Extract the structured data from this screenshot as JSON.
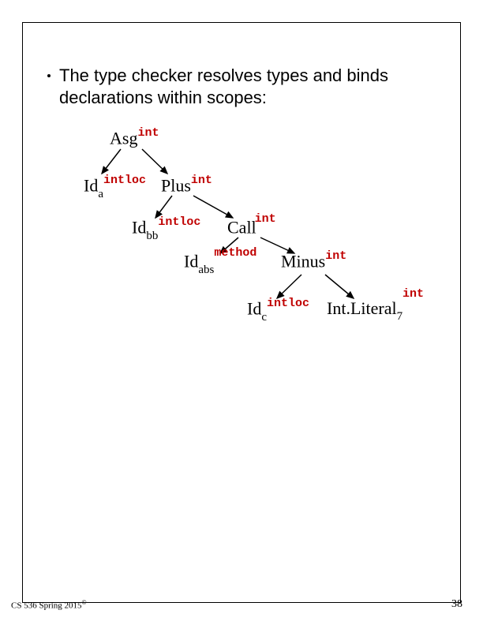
{
  "bullet": "The type checker resolves types and binds declarations within scopes:",
  "nodes": {
    "asg": {
      "base": "Asg",
      "sub": "",
      "sup": "int"
    },
    "id_a": {
      "base": "Id",
      "sub": "a",
      "sup": "intloc"
    },
    "plus": {
      "base": "Plus",
      "sub": "",
      "sup": "int"
    },
    "id_bb": {
      "base": "Id",
      "sub": "bb",
      "sup": "intloc"
    },
    "call": {
      "base": "Call",
      "sub": "",
      "sup": "int"
    },
    "id_abs": {
      "base": "Id",
      "sub": "abs",
      "sup": "method"
    },
    "minus": {
      "base": "Minus",
      "sub": "",
      "sup": "int"
    },
    "id_c": {
      "base": "Id",
      "sub": "c",
      "sup": "intloc"
    },
    "intlit": {
      "base": "Int.Literal",
      "sub": "7",
      "sup": "int"
    }
  },
  "footer": {
    "left": "CS 536  Spring 2015",
    "copyright": "©",
    "right": "38"
  }
}
